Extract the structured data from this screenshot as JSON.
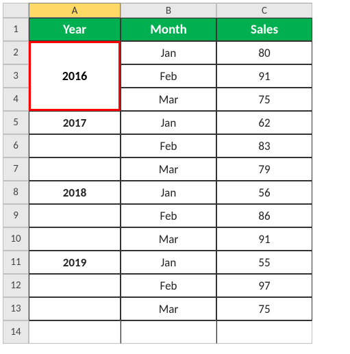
{
  "columns": {
    "corner": "",
    "A": "A",
    "B": "B",
    "C": "C"
  },
  "headers": {
    "year": "Year",
    "month": "Month",
    "sales": "Sales"
  },
  "rows": [
    {
      "num": "1"
    },
    {
      "num": "2",
      "year": "",
      "month": "Jan",
      "sales": "80"
    },
    {
      "num": "3",
      "year": "2016",
      "month": "Feb",
      "sales": "91"
    },
    {
      "num": "4",
      "year": "",
      "month": "Mar",
      "sales": "75"
    },
    {
      "num": "5",
      "year": "2017",
      "month": "Jan",
      "sales": "62"
    },
    {
      "num": "6",
      "year": "",
      "month": "Feb",
      "sales": "83"
    },
    {
      "num": "7",
      "year": "",
      "month": "Mar",
      "sales": "79"
    },
    {
      "num": "8",
      "year": "2018",
      "month": "Jan",
      "sales": "56"
    },
    {
      "num": "9",
      "year": "",
      "month": "Feb",
      "sales": "86"
    },
    {
      "num": "10",
      "year": "",
      "month": "Mar",
      "sales": "91"
    },
    {
      "num": "11",
      "year": "2019",
      "month": "Jan",
      "sales": "55"
    },
    {
      "num": "12",
      "year": "",
      "month": "Feb",
      "sales": "97"
    },
    {
      "num": "13",
      "year": "",
      "month": "Mar",
      "sales": "75"
    },
    {
      "num": "14",
      "year": "",
      "month": "",
      "sales": ""
    }
  ],
  "merged_year": "2016",
  "chart_data": {
    "type": "table",
    "title": "",
    "columns": [
      "Year",
      "Month",
      "Sales"
    ],
    "data": [
      {
        "Year": 2016,
        "Month": "Jan",
        "Sales": 80
      },
      {
        "Year": 2016,
        "Month": "Feb",
        "Sales": 91
      },
      {
        "Year": 2016,
        "Month": "Mar",
        "Sales": 75
      },
      {
        "Year": 2017,
        "Month": "Jan",
        "Sales": 62
      },
      {
        "Year": 2017,
        "Month": "Feb",
        "Sales": 83
      },
      {
        "Year": 2017,
        "Month": "Mar",
        "Sales": 79
      },
      {
        "Year": 2018,
        "Month": "Jan",
        "Sales": 56
      },
      {
        "Year": 2018,
        "Month": "Feb",
        "Sales": 86
      },
      {
        "Year": 2018,
        "Month": "Mar",
        "Sales": 91
      },
      {
        "Year": 2019,
        "Month": "Jan",
        "Sales": 55
      },
      {
        "Year": 2019,
        "Month": "Feb",
        "Sales": 97
      },
      {
        "Year": 2019,
        "Month": "Mar",
        "Sales": 75
      }
    ]
  }
}
